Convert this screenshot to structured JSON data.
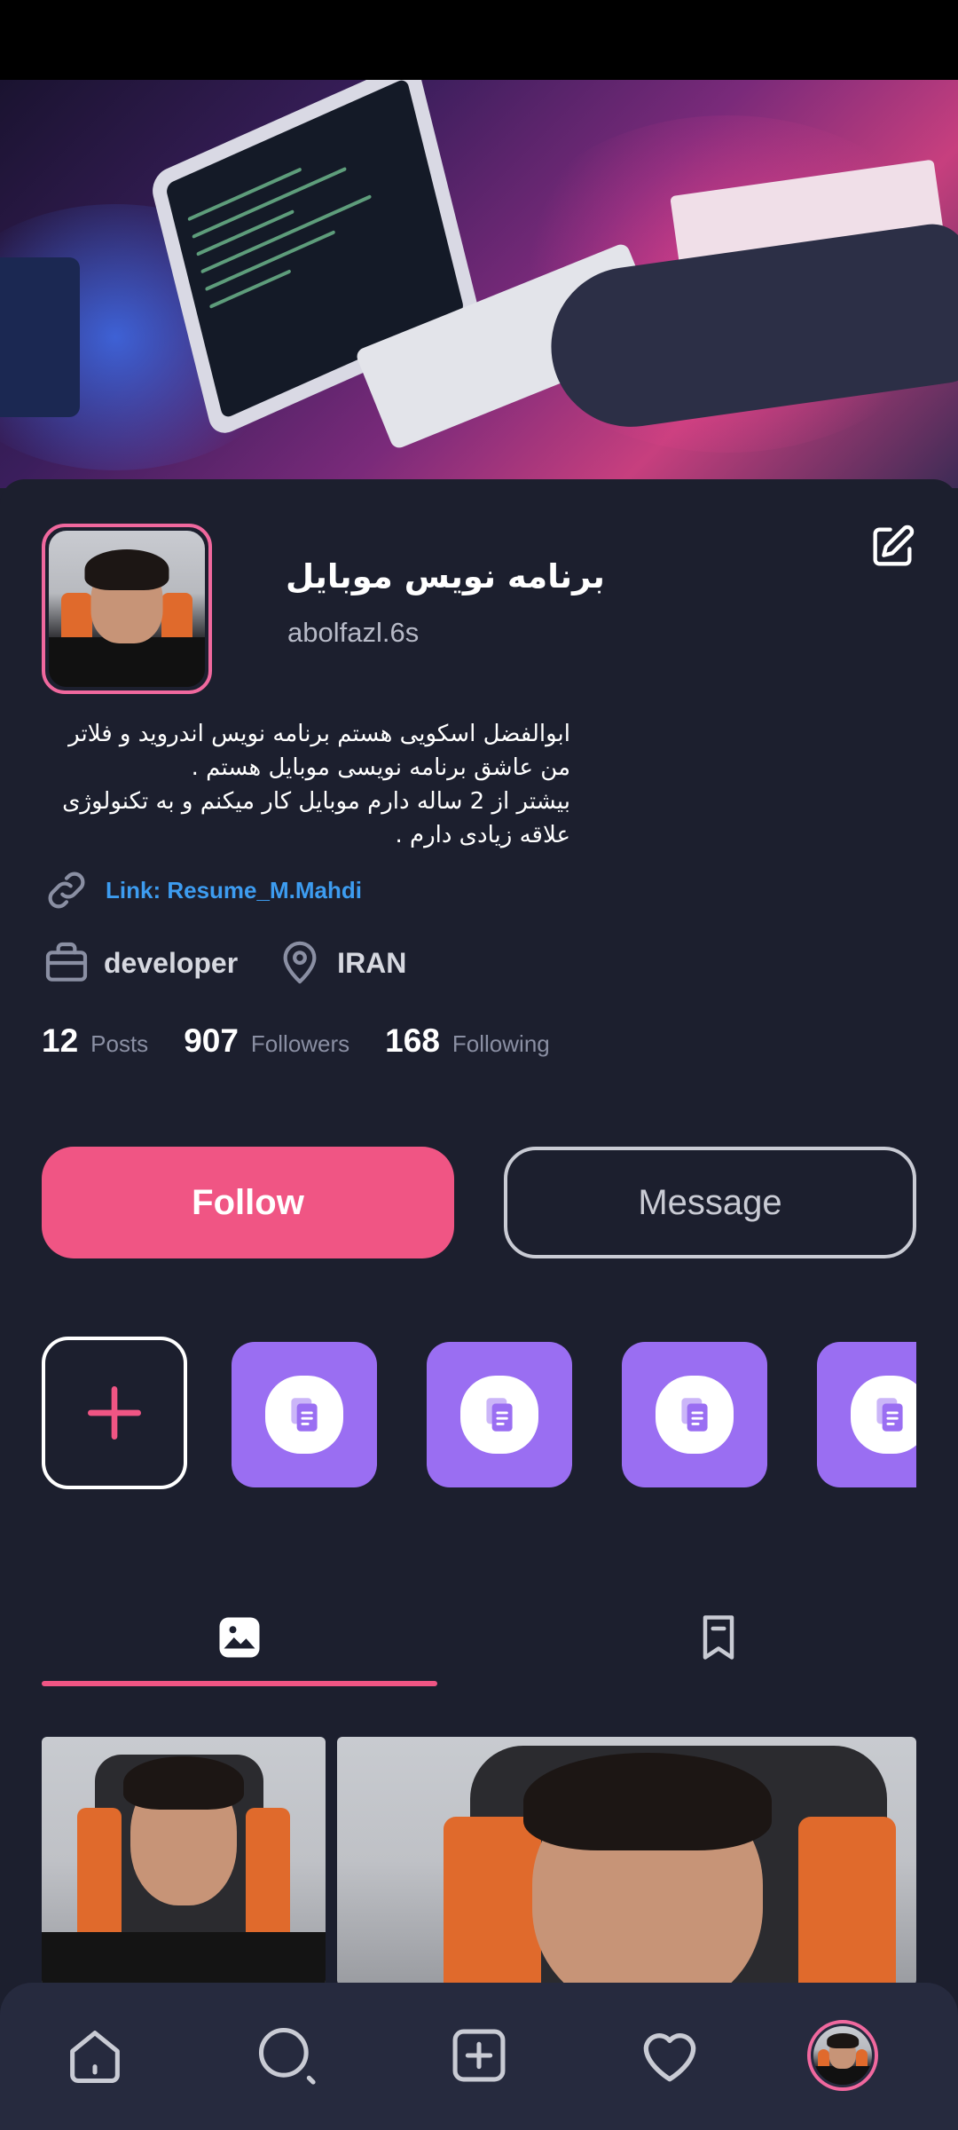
{
  "profile": {
    "title": "برنامه نویس موبایل",
    "username": "abolfazl.6s",
    "bio_lines": [
      "ابوالفضل اسکویی هستم برنامه نویس اندروید و فلاتر",
      "من عاشق برنامه نویسی موبایل هستم .",
      "بیشتر از 2 ساله دارم موبایل کار میکنم و به تکنولوژی",
      "علاقه زیادی دارم ."
    ],
    "link": "Link: Resume_M.Mahdi",
    "job": "developer",
    "location": "IRAN"
  },
  "stats": {
    "posts_count": "12",
    "posts_label": "Posts",
    "followers_count": "907",
    "followers_label": "Followers",
    "following_count": "168",
    "following_label": "Following"
  },
  "actions": {
    "follow_label": "Follow",
    "message_label": "Message"
  },
  "icons": {
    "edit": "edit-icon",
    "link": "link-icon",
    "job": "briefcase-icon",
    "location": "location-pin-icon",
    "add_highlight": "plus-icon",
    "highlight": "document-icon",
    "tab_posts": "image-icon",
    "tab_saved": "bookmark-icon",
    "nav_home": "home-icon",
    "nav_search": "search-icon",
    "nav_add": "add-square-icon",
    "nav_likes": "heart-icon"
  },
  "colors": {
    "background": "#1c1f2e",
    "accent": "#f05584",
    "highlight": "#9a6ef2",
    "link": "#3d9cf0",
    "nav": "#262a3e"
  }
}
